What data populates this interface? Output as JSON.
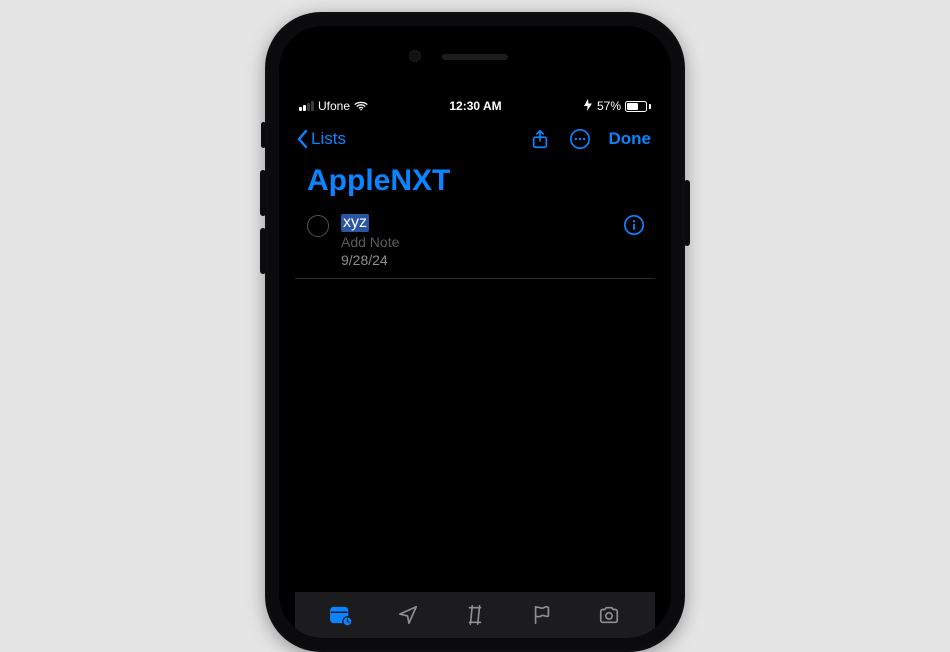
{
  "status": {
    "carrier": "Ufone",
    "time": "12:30 AM",
    "battery_percent": "57%"
  },
  "navbar": {
    "back_label": "Lists",
    "done_label": "Done"
  },
  "list": {
    "title": "AppleNXT"
  },
  "reminder": {
    "title": "xyz",
    "note_placeholder": "Add Note",
    "date": "9/28/24"
  },
  "icons": {
    "back": "chevron-left-icon",
    "share": "share-icon",
    "more": "ellipsis-circle-icon",
    "info": "info-circle-icon",
    "wifi": "wifi-icon",
    "charging": "charging-icon",
    "calendar": "calendar-badge-icon",
    "location": "location-icon",
    "tag": "tag-icon",
    "flag": "flag-icon",
    "camera": "camera-icon"
  },
  "colors": {
    "accent": "#0a84ff",
    "background": "#000000",
    "toolbar_bg": "#1c1c1e",
    "text_secondary": "#8e8e93",
    "selection": "#2955a3"
  }
}
